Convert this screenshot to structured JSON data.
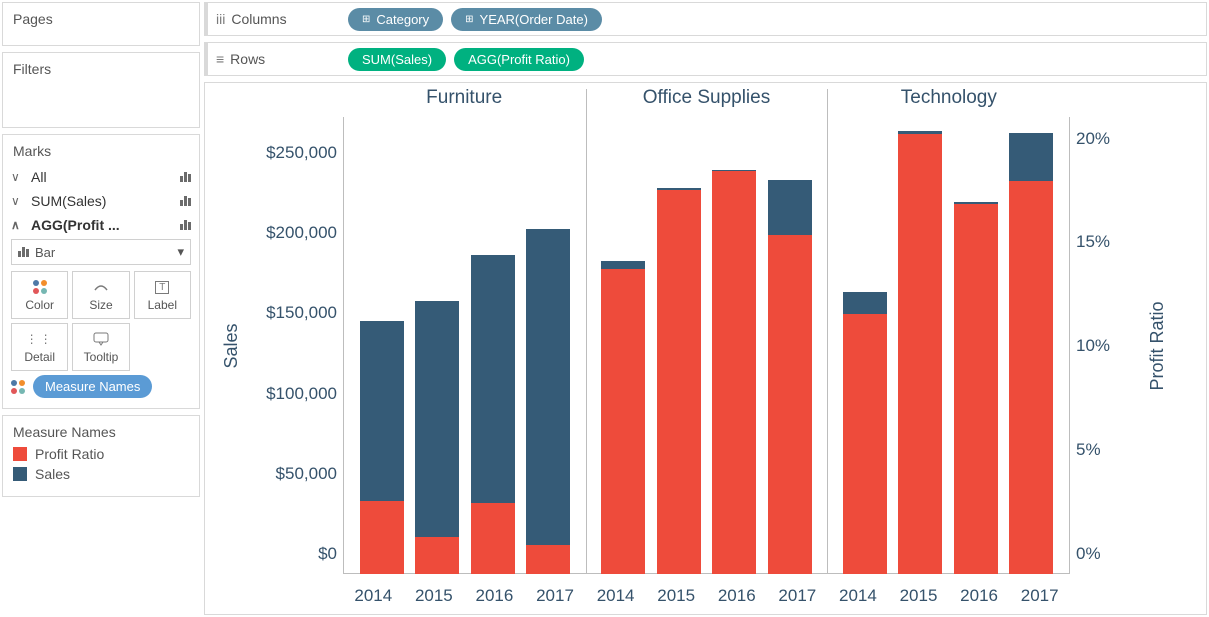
{
  "left": {
    "pages_title": "Pages",
    "filters_title": "Filters",
    "marks_title": "Marks",
    "marks_rows": [
      {
        "label": "All",
        "expanded": false,
        "caret": "∨"
      },
      {
        "label": "SUM(Sales)",
        "expanded": false,
        "caret": "∨"
      },
      {
        "label": "AGG(Profit ...",
        "expanded": true,
        "caret": "∧"
      }
    ],
    "mark_type": "Bar",
    "mark_cells": [
      "Color",
      "Size",
      "Label",
      "Detail",
      "Tooltip"
    ],
    "measure_names_pill": "Measure Names",
    "legend_title": "Measure Names",
    "legend_items": [
      {
        "label": "Profit Ratio",
        "color": "red"
      },
      {
        "label": "Sales",
        "color": "blue"
      }
    ]
  },
  "shelves": {
    "columns_label": "Columns",
    "columns_pills": [
      "Category",
      "YEAR(Order Date)"
    ],
    "rows_label": "Rows",
    "rows_pills": [
      "SUM(Sales)",
      "AGG(Profit Ratio)"
    ]
  },
  "chart_data": {
    "type": "bar",
    "categories": [
      "Furniture",
      "Office Supplies",
      "Technology"
    ],
    "years": [
      "2014",
      "2015",
      "2016",
      "2017"
    ],
    "left_axis": {
      "label": "Sales",
      "ticks": [
        "$0",
        "$50,000",
        "$100,000",
        "$150,000",
        "$200,000",
        "$250,000"
      ],
      "max": 285000
    },
    "right_axis": {
      "label": "Profit Ratio",
      "ticks": [
        "0%",
        "5%",
        "10%",
        "15%",
        "20%"
      ],
      "max": 22
    },
    "series": [
      {
        "category": "Furniture",
        "bars": [
          {
            "year": "2014",
            "sales": 158000,
            "profit_ratio": 3.5
          },
          {
            "year": "2015",
            "sales": 170000,
            "profit_ratio": 1.8
          },
          {
            "year": "2016",
            "sales": 199000,
            "profit_ratio": 3.4
          },
          {
            "year": "2017",
            "sales": 215000,
            "profit_ratio": 1.4
          }
        ]
      },
      {
        "category": "Office Supplies",
        "bars": [
          {
            "year": "2014",
            "sales": 195000,
            "profit_ratio": 14.7
          },
          {
            "year": "2015",
            "sales": 241000,
            "profit_ratio": 18.5
          },
          {
            "year": "2016",
            "sales": 252000,
            "profit_ratio": 19.4
          },
          {
            "year": "2017",
            "sales": 246000,
            "profit_ratio": 16.3
          }
        ]
      },
      {
        "category": "Technology",
        "bars": [
          {
            "year": "2014",
            "sales": 176000,
            "profit_ratio": 12.5
          },
          {
            "year": "2015",
            "sales": 276000,
            "profit_ratio": 21.2
          },
          {
            "year": "2016",
            "sales": 232000,
            "profit_ratio": 17.8
          },
          {
            "year": "2017",
            "sales": 275000,
            "profit_ratio": 18.9
          }
        ]
      }
    ]
  }
}
